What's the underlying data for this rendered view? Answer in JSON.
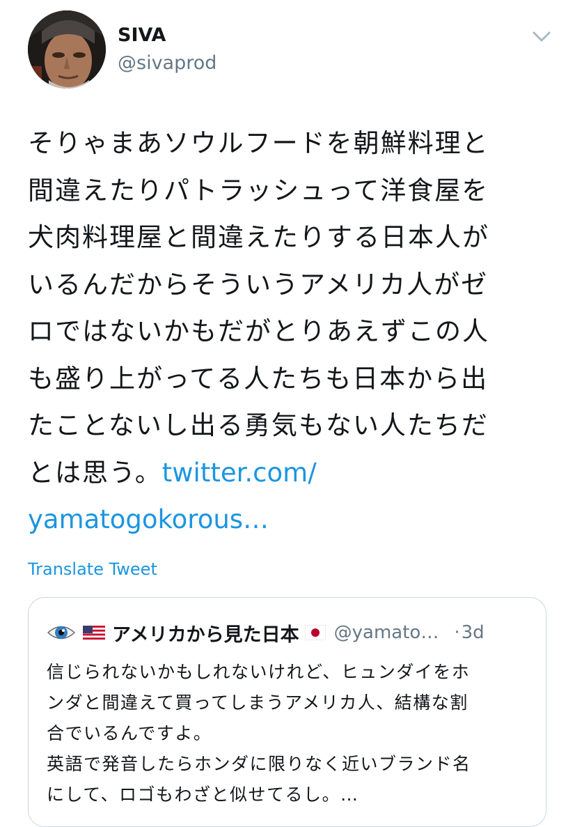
{
  "user": {
    "name": "SIVA",
    "handle": "@sivaprod"
  },
  "tweet": {
    "lines": [
      "そりゃまあソウルフードを朝鮮料理と",
      "間違えたりパトラッシュって洋食屋を",
      "犬肉料理屋と間違えたりする日本人が",
      "いるんだからそういうアメリカ人がゼ",
      "ロではないかもだがとりあえずこの人",
      "も盛り上がってる人たちも日本から出",
      "たことないし出る勇気もない人たちだ"
    ],
    "last_line_text": "とは思う。",
    "link_part1": "twitter.com/",
    "link_part2": "yamatogokorous…"
  },
  "translate_label": "Translate Tweet",
  "quoted": {
    "name": "アメリカから見た日本",
    "handle": "@yamato…",
    "separator": "·",
    "time": "3d",
    "lines": [
      "信じられないかもしれないけれど、ヒュンダイをホ",
      "ンダと間違えて買ってしまうアメリカ人、結構な割",
      "合でいるんですよ。",
      "英語で発音したらホンダに限りなく近いブランド名",
      "にして、ロゴもわざと似せてるし。…"
    ]
  },
  "icons": {
    "avatar": "profile-photo",
    "menu": "chevron-down-icon",
    "quoted_emoji_1": "eye-icon",
    "quoted_emoji_2": "us-flag-icon",
    "quoted_emoji_3": "japan-flag-icon"
  },
  "colors": {
    "link": "#1b95e0",
    "secondary_text": "#657786",
    "border": "#ccd6dd"
  }
}
